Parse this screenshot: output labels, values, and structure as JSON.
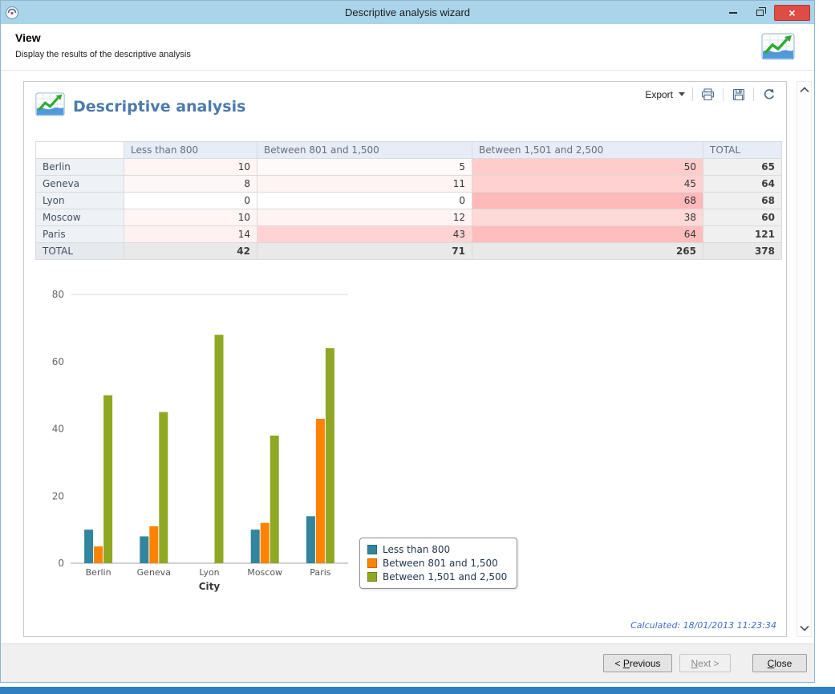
{
  "window": {
    "title": "Descriptive analysis wizard",
    "controls": {
      "minimize": "–",
      "close": "×"
    }
  },
  "header": {
    "title": "View",
    "subtitle": "Display the results of the descriptive analysis"
  },
  "toolbar": {
    "export_label": "Export"
  },
  "panel": {
    "heading": "Descriptive analysis",
    "calculated_text": "Calculated: 18/01/2013 11:23:34"
  },
  "table": {
    "columns": [
      "",
      "Less than 800",
      "Between 801 and 1,500",
      "Between 1,501 and 2,500",
      "TOTAL"
    ],
    "rows": [
      {
        "label": "Berlin",
        "values": [
          10,
          5,
          50
        ],
        "total": 65,
        "is_total": false
      },
      {
        "label": "Geneva",
        "values": [
          8,
          11,
          45
        ],
        "total": 64,
        "is_total": false
      },
      {
        "label": "Lyon",
        "values": [
          0,
          0,
          68
        ],
        "total": 68,
        "is_total": false
      },
      {
        "label": "Moscow",
        "values": [
          10,
          12,
          38
        ],
        "total": 60,
        "is_total": false
      },
      {
        "label": "Paris",
        "values": [
          14,
          43,
          64
        ],
        "total": 121,
        "is_total": false
      },
      {
        "label": "TOTAL",
        "values": [
          42,
          71,
          265
        ],
        "total": 378,
        "is_total": true
      }
    ],
    "heatmap_max": 68
  },
  "chart_data": {
    "type": "bar",
    "categories": [
      "Berlin",
      "Geneva",
      "Lyon",
      "Moscow",
      "Paris"
    ],
    "series": [
      {
        "name": "Less than 800",
        "color": "#31859C",
        "values": [
          10,
          8,
          0,
          10,
          14
        ]
      },
      {
        "name": "Between 801 and 1,500",
        "color": "#FF8200",
        "values": [
          5,
          11,
          0,
          12,
          43
        ]
      },
      {
        "name": "Between 1,501 and 2,500",
        "color": "#8FA824",
        "values": [
          50,
          45,
          68,
          38,
          64
        ]
      }
    ],
    "xlabel": "City",
    "ylabel": "",
    "ylim": [
      0,
      80
    ],
    "yticks": [
      0,
      20,
      40,
      60,
      80
    ],
    "grid": "top-line-only",
    "legend_position": "right-of-plot-bottom"
  },
  "footer": {
    "previous": {
      "prefix": "< ",
      "key": "P",
      "rest": "revious"
    },
    "next": {
      "prefix": "",
      "key": "N",
      "rest": "ext >"
    },
    "close": {
      "prefix": "",
      "key": "C",
      "rest": "lose"
    }
  }
}
